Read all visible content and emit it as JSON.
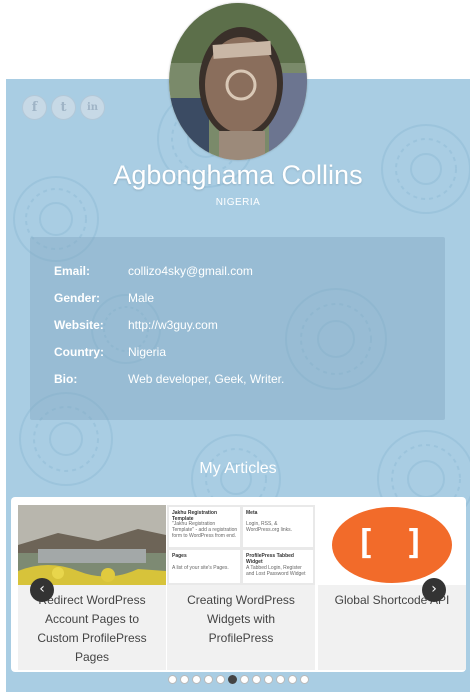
{
  "profile": {
    "name": "Agbonghama Collins",
    "country": "NIGERIA"
  },
  "social": [
    {
      "name": "facebook-icon",
      "glyph": "f"
    },
    {
      "name": "twitter-icon",
      "glyph": "t"
    },
    {
      "name": "linkedin-icon",
      "glyph": "in"
    }
  ],
  "details": [
    {
      "label": "Email:",
      "value": "collizo4sky@gmail.com"
    },
    {
      "label": "Gender:",
      "value": "Male"
    },
    {
      "label": "Website:",
      "value": "http://w3guy.com"
    },
    {
      "label": "Country:",
      "value": "Nigeria"
    },
    {
      "label": "Bio:",
      "value": "Web developer, Geek, Writer."
    }
  ],
  "articles": {
    "title": "My Articles",
    "items": [
      {
        "lines": [
          "Redirect WordPress",
          "Account Pages to",
          "Custom ProfilePress",
          "Pages"
        ]
      },
      {
        "lines": [
          "Creating WordPress",
          "Widgets with",
          "ProfilePress"
        ]
      },
      {
        "lines": [
          "Global Shortcode API"
        ]
      }
    ],
    "prev": "‹",
    "next": "›",
    "dot_count": 12,
    "active_dot": 5
  },
  "thumb2": {
    "widget1_title": "Jakhu Registration Template",
    "widget1_body": "\"Jakhu Registration Template\" - add a registration form to WordPress from end.",
    "widget2_title": "Meta",
    "widget2_body": "Login, RSS, & WordPress.org links.",
    "widget3_title": "Pages",
    "widget3_body": "A list of your site's Pages.",
    "widget4_title": "ProfilePress Tabbed Widget",
    "widget4_body": "A Tabbed Login, Register and Lost Password Widget"
  },
  "thumb3": {
    "glyph": "[ ]"
  },
  "colors": {
    "card_bg": "#a9cde3",
    "accent_orange": "#f26b2a"
  }
}
